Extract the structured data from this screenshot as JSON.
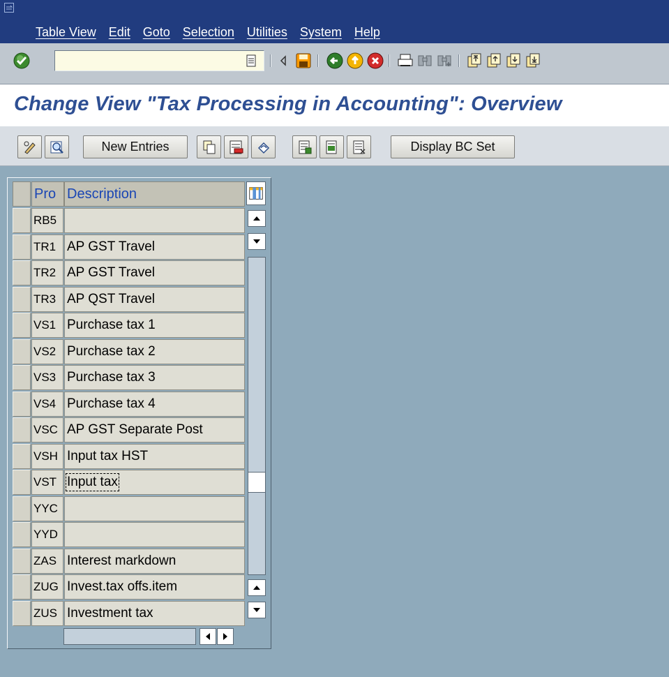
{
  "menu": [
    "Table View",
    "Edit",
    "Goto",
    "Selection",
    "Utilities",
    "System",
    "Help"
  ],
  "toolbar": {
    "command_field": "",
    "icons": [
      "enter-icon",
      "dropdown-icon",
      "back-icon",
      "save-icon",
      "back-navigate-icon",
      "exit-icon",
      "cancel-icon",
      "print-icon",
      "find-icon",
      "find-next-icon",
      "first-page-icon",
      "previous-page-icon",
      "next-page-icon",
      "last-page-icon"
    ]
  },
  "title": "Change View \"Tax Processing in Accounting\": Overview",
  "app_toolbar": {
    "new_entries": "New Entries",
    "display_bc_set": "Display BC Set"
  },
  "table": {
    "columns": [
      "Pro",
      "Description"
    ],
    "rows": [
      {
        "proc": "RB5",
        "desc": ""
      },
      {
        "proc": "TR1",
        "desc": "AP GST Travel"
      },
      {
        "proc": "TR2",
        "desc": "AP GST Travel"
      },
      {
        "proc": "TR3",
        "desc": "AP  QST  Travel"
      },
      {
        "proc": "VS1",
        "desc": "Purchase tax 1"
      },
      {
        "proc": "VS2",
        "desc": "Purchase tax 2"
      },
      {
        "proc": "VS3",
        "desc": "Purchase tax 3"
      },
      {
        "proc": "VS4",
        "desc": "Purchase tax 4"
      },
      {
        "proc": "VSC",
        "desc": "AP GST Separate Post"
      },
      {
        "proc": "VSH",
        "desc": "Input tax HST"
      },
      {
        "proc": "VST",
        "desc": "Input tax"
      },
      {
        "proc": "YYC",
        "desc": ""
      },
      {
        "proc": "YYD",
        "desc": ""
      },
      {
        "proc": "ZAS",
        "desc": "Interest markdown"
      },
      {
        "proc": "ZUG",
        "desc": "Invest.tax offs.item"
      },
      {
        "proc": "ZUS",
        "desc": "Investment tax"
      }
    ],
    "focused_row": 10
  },
  "colors": {
    "menubar": "#213c7f",
    "title_text": "#2e4f93",
    "background": "#8faabb",
    "header_text": "#1a46b4"
  }
}
